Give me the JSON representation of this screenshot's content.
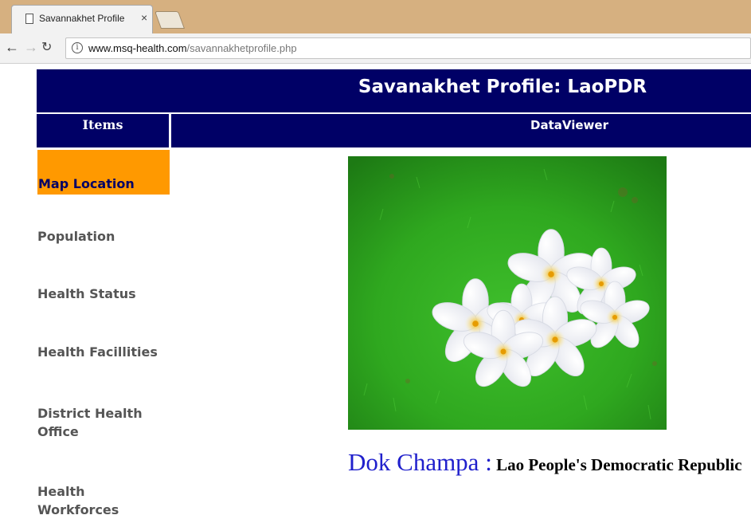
{
  "browser": {
    "tab_title": "Savannakhet Profile",
    "tab_close": "×",
    "url_host": "www.msq-health.com",
    "url_path": "/savannakhetprofile.php"
  },
  "page": {
    "title": "Savanakhet Profile: LaoPDR",
    "items_header": "Items",
    "viewer_header": "DataViewer"
  },
  "menu": {
    "items": [
      "Map Location",
      "Population",
      "Health Status",
      "Health Facillities",
      "District Health Office",
      "Health Workforces"
    ],
    "active_index": 0
  },
  "caption": {
    "flower_name": "Dok Champa :",
    "country": " Lao People's Democratic Republic"
  },
  "colors": {
    "header_bg": "#000066",
    "active_item_bg": "#ff9900",
    "caption_blue": "#2020cc"
  },
  "icons": {
    "tab": "page-icon",
    "back": "back-arrow-icon",
    "forward": "forward-arrow-icon",
    "reload": "reload-icon",
    "info": "info-icon"
  }
}
